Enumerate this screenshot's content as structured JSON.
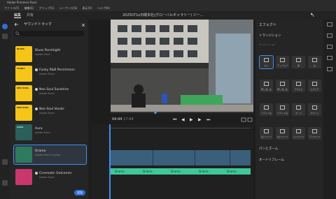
{
  "window": {
    "title": "Adobe Premiere Rush"
  },
  "menu": [
    "ファイル(F)",
    "編集(E)",
    "クリップ(C)",
    "シーケンス(S)",
    "表示(V)",
    "ヘルプ(H)"
  ],
  "tabs": {
    "edit": "編集",
    "share": "共有"
  },
  "document_title": "2025071x日曜本社(グローバルギャラリー) ジー...",
  "media": {
    "header": "サウンドトラック",
    "search_placeholder": "",
    "tracks": [
      {
        "title": "Blues Porchlight",
        "sub": "Adobe Stock",
        "color": "#f5c518",
        "thumb": "BLUES"
      },
      {
        "title": "Funky R&B Persimmon",
        "sub": "Adobe Stock",
        "color": "#f5c518",
        "thumb": "FUNKY"
      },
      {
        "title": "Neo Soul Sunshine",
        "sub": "Adobe Stock",
        "color": "#f5c518",
        "thumb": "NEO SOUL"
      },
      {
        "title": "Neo Soul Vocals",
        "sub": "Adobe Stock",
        "color": "#f5c518",
        "thumb": "NEO SOUL"
      },
      {
        "title": "Aura",
        "sub": "Adobe Stock",
        "color": "#2c5e5a",
        "thumb": "AURA"
      },
      {
        "title": "Drama",
        "sub": "Adobe Stock Cinema",
        "color": "#2d7a5f",
        "thumb": ""
      },
      {
        "title": "Cinematic Outcomer",
        "sub": "Adobe Stock",
        "color": "#c9376c",
        "thumb": ""
      }
    ],
    "add_button": "追加"
  },
  "player": {
    "time": "04:44",
    "duration": "17:44"
  },
  "timeline": {
    "audio_label": "Drama",
    "clip_count": 6
  },
  "effects": {
    "title": "エフェクト",
    "section_transitions": "トランジション",
    "duration_label": "デュレーション",
    "tiles": [
      "なし",
      "ディゾルブ",
      "黒",
      "白",
      "押し出し左",
      "押し出し右",
      "下から上",
      "上から下",
      "スライド左",
      "スライド右",
      "ズーム",
      "ホワイト",
      "左にワイプ",
      "右にワイプ",
      "上へワイプ",
      "下へワイプ"
    ],
    "section_pan": "パンとズーム",
    "section_autoframe": "オートリフレーム",
    "accent": "#3f8ff2"
  },
  "colors": {
    "accent": "#3f8ff2",
    "audio_clip": "#3fc79a",
    "video_clip": "#3a5f7a",
    "playhead": "#3f8ff2"
  }
}
